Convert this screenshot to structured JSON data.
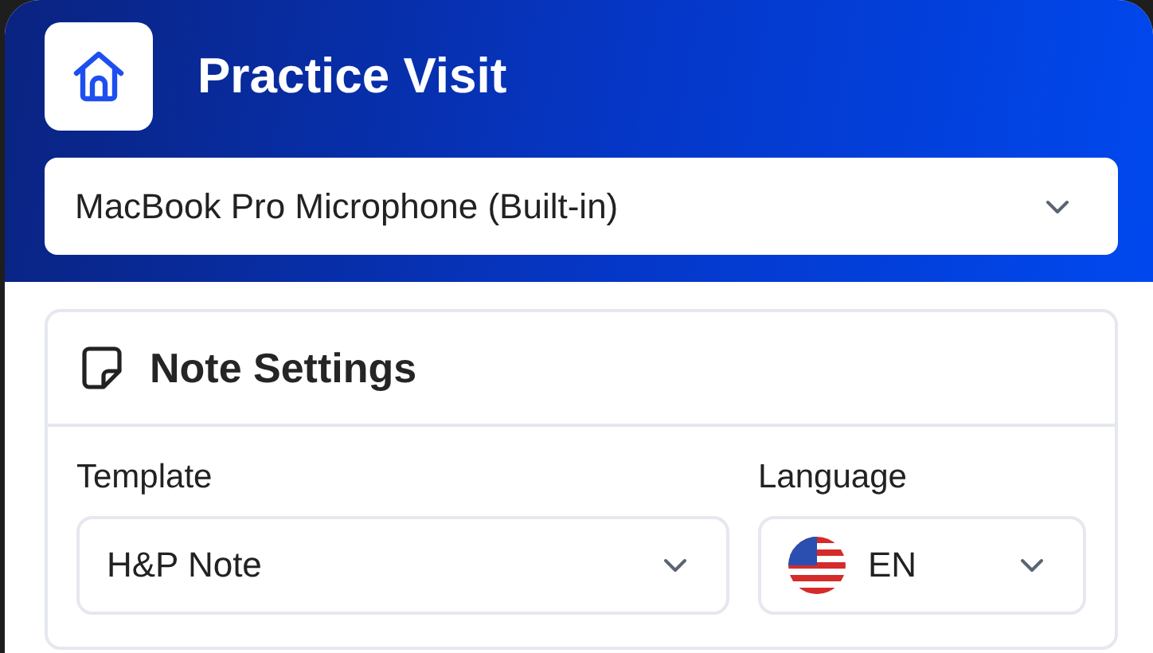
{
  "header": {
    "title": "Practice Visit"
  },
  "microphone_select": {
    "value": "MacBook Pro Microphone (Built-in)"
  },
  "note_settings": {
    "title": "Note Settings",
    "fields": [
      {
        "kind": "select",
        "label": "Template",
        "value": "H&P Note"
      },
      {
        "kind": "language",
        "label": "Language",
        "value": "EN"
      }
    ]
  }
}
